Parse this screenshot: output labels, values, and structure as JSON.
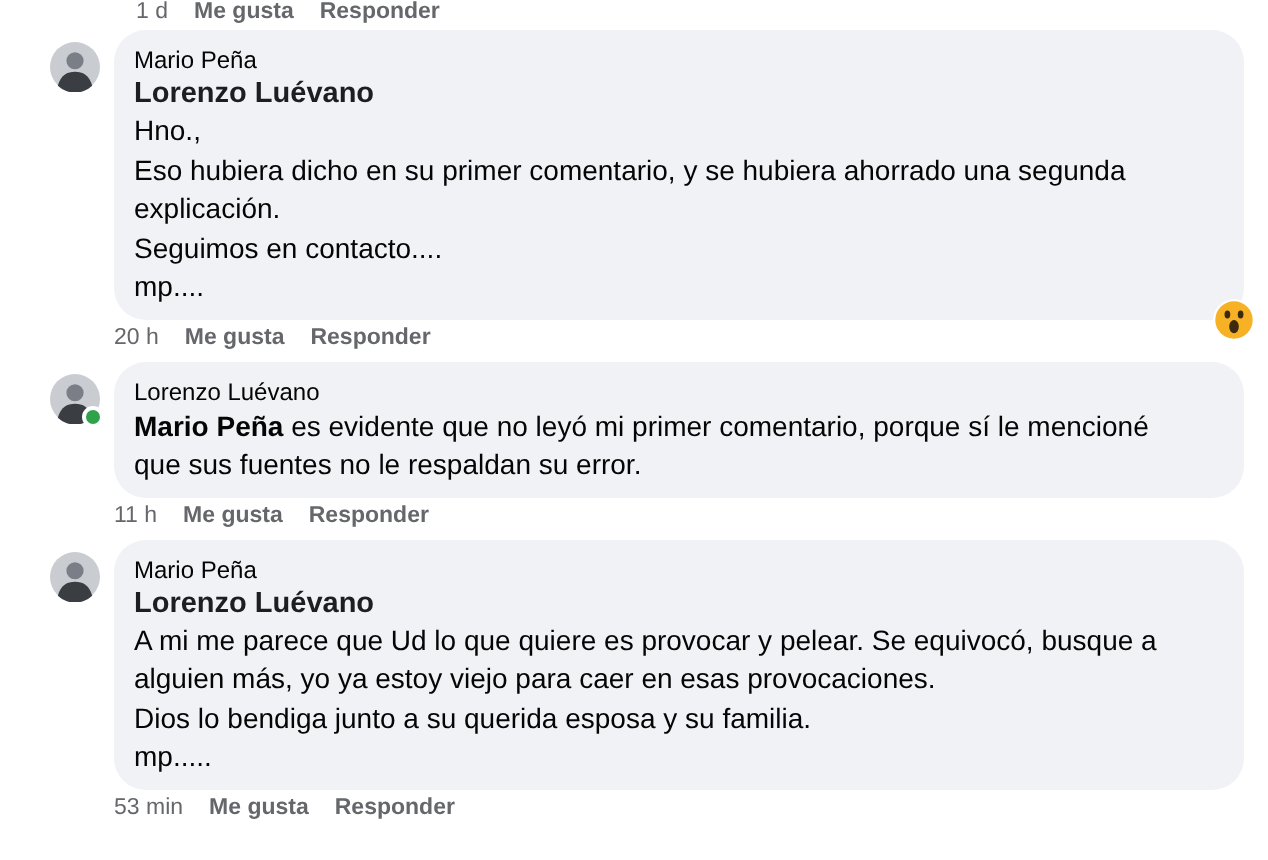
{
  "partial_actions": {
    "time": "1 d",
    "like": "Me gusta",
    "reply": "Responder"
  },
  "comments": [
    {
      "author": "Mario Peña",
      "online": false,
      "mention": "Lorenzo Luévano",
      "paragraphs": [
        "Hno.,",
        "Eso hubiera dicho en su primer comentario, y se hubiera ahorrado una segunda explicación.",
        "Seguimos en contacto....",
        "mp...."
      ],
      "reactions": [
        {
          "kind": "wow"
        }
      ],
      "time": "20 h",
      "like": "Me gusta",
      "reply": "Responder"
    },
    {
      "author": "Lorenzo Luévano",
      "online": true,
      "paragraphs": [
        "**Mario Peña** es evidente que no leyó mi primer comentario, porque sí le mencioné que sus fuentes no le respaldan su error."
      ],
      "time": "11 h",
      "like": "Me gusta",
      "reply": "Responder"
    },
    {
      "author": "Mario Peña",
      "online": false,
      "mention": "Lorenzo Luévano",
      "paragraphs": [
        "A mi me parece que Ud lo que quiere es provocar y pelear. Se equivocó, busque a alguien más, yo ya estoy viejo para caer en esas provocaciones.",
        "Dios lo bendiga junto a su querida esposa y su familia.",
        "mp....."
      ],
      "time": "53 min",
      "like": "Me gusta",
      "reply": "Responder"
    }
  ]
}
